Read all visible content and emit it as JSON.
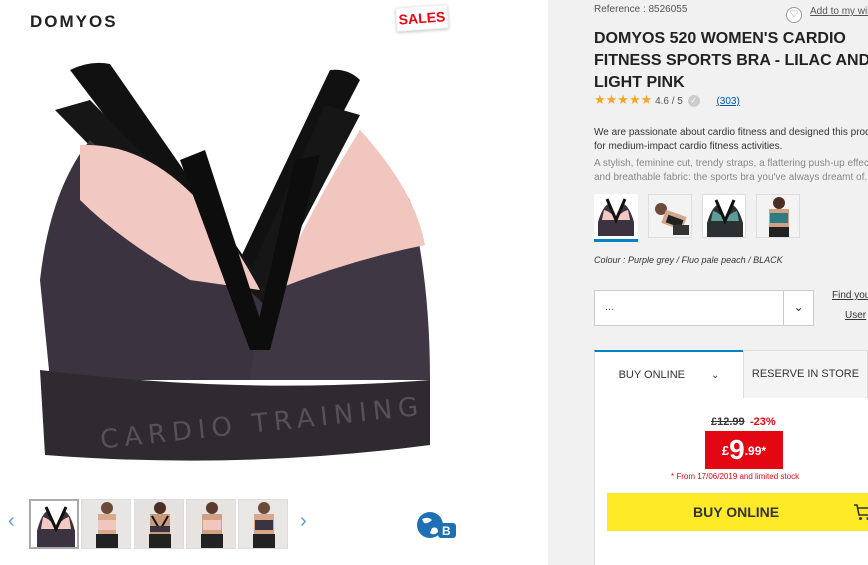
{
  "brand": "DOMYOS",
  "sales_badge": "SALES",
  "reference": "Reference : 8526055",
  "wishlist": "Add to my wis",
  "title": "DOMYOS 520 WOMEN'S CARDIO FITNESS SPORTS BRA - LILAC AND LIGHT PINK",
  "rating": {
    "stars": "★★★★★",
    "score": "4.6 / 5",
    "reviews": "(303)"
  },
  "description": {
    "intro": "We are passionate about cardio fitness and designed this product for medium-impact cardio fitness activities.",
    "detail": "A stylish, feminine cut, trendy straps, a flattering push-up effect and breathable fabric: the sports bra you've always dreamt of."
  },
  "colour": "Colour : Purple grey / Fluo pale peach / BLACK",
  "size_select": {
    "value": "..."
  },
  "links": {
    "find_size": "Find your",
    "user": "User"
  },
  "tabs": {
    "buy": "BUY ONLINE",
    "reserve": "RESERVE IN STORE"
  },
  "price": {
    "old": "£12.99",
    "discount": "-23%",
    "currency": "£",
    "integer": "9",
    "decimal": ".99*",
    "note": "* From 17/06/2019 and limited stock"
  },
  "buy_button": "BUY ONLINE",
  "colors": {
    "accent": "#0082c3",
    "sale": "#e30613",
    "button": "#ffea28"
  },
  "icons": [
    "heart-icon",
    "check-icon",
    "chevron-down-icon",
    "cart-icon",
    "globe-icon",
    "arrow-left-icon",
    "arrow-right-icon"
  ]
}
